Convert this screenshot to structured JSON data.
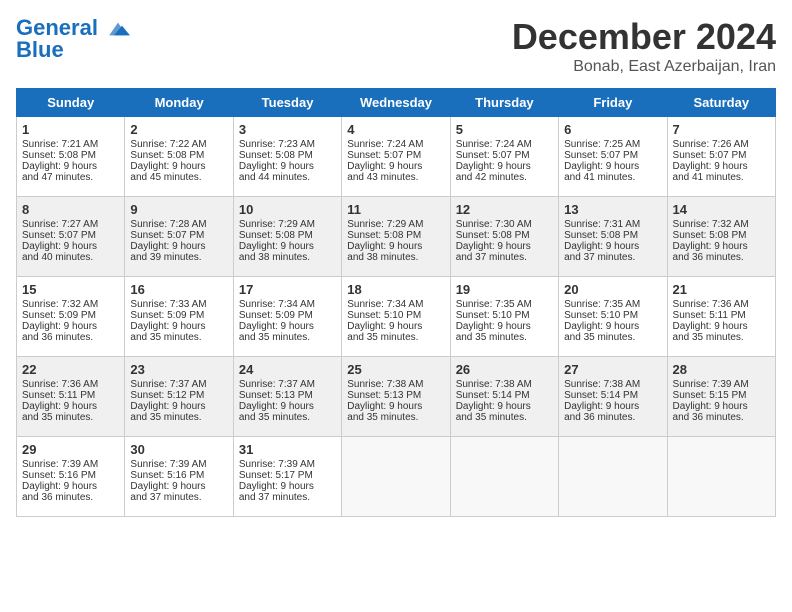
{
  "header": {
    "logo_line1": "General",
    "logo_line2": "Blue",
    "title": "December 2024",
    "subtitle": "Bonab, East Azerbaijan, Iran"
  },
  "days_of_week": [
    "Sunday",
    "Monday",
    "Tuesday",
    "Wednesday",
    "Thursday",
    "Friday",
    "Saturday"
  ],
  "weeks": [
    [
      {
        "day": "1",
        "lines": [
          "Sunrise: 7:21 AM",
          "Sunset: 5:08 PM",
          "Daylight: 9 hours",
          "and 47 minutes."
        ]
      },
      {
        "day": "2",
        "lines": [
          "Sunrise: 7:22 AM",
          "Sunset: 5:08 PM",
          "Daylight: 9 hours",
          "and 45 minutes."
        ]
      },
      {
        "day": "3",
        "lines": [
          "Sunrise: 7:23 AM",
          "Sunset: 5:08 PM",
          "Daylight: 9 hours",
          "and 44 minutes."
        ]
      },
      {
        "day": "4",
        "lines": [
          "Sunrise: 7:24 AM",
          "Sunset: 5:07 PM",
          "Daylight: 9 hours",
          "and 43 minutes."
        ]
      },
      {
        "day": "5",
        "lines": [
          "Sunrise: 7:24 AM",
          "Sunset: 5:07 PM",
          "Daylight: 9 hours",
          "and 42 minutes."
        ]
      },
      {
        "day": "6",
        "lines": [
          "Sunrise: 7:25 AM",
          "Sunset: 5:07 PM",
          "Daylight: 9 hours",
          "and 41 minutes."
        ]
      },
      {
        "day": "7",
        "lines": [
          "Sunrise: 7:26 AM",
          "Sunset: 5:07 PM",
          "Daylight: 9 hours",
          "and 41 minutes."
        ]
      }
    ],
    [
      {
        "day": "8",
        "lines": [
          "Sunrise: 7:27 AM",
          "Sunset: 5:07 PM",
          "Daylight: 9 hours",
          "and 40 minutes."
        ]
      },
      {
        "day": "9",
        "lines": [
          "Sunrise: 7:28 AM",
          "Sunset: 5:07 PM",
          "Daylight: 9 hours",
          "and 39 minutes."
        ]
      },
      {
        "day": "10",
        "lines": [
          "Sunrise: 7:29 AM",
          "Sunset: 5:08 PM",
          "Daylight: 9 hours",
          "and 38 minutes."
        ]
      },
      {
        "day": "11",
        "lines": [
          "Sunrise: 7:29 AM",
          "Sunset: 5:08 PM",
          "Daylight: 9 hours",
          "and 38 minutes."
        ]
      },
      {
        "day": "12",
        "lines": [
          "Sunrise: 7:30 AM",
          "Sunset: 5:08 PM",
          "Daylight: 9 hours",
          "and 37 minutes."
        ]
      },
      {
        "day": "13",
        "lines": [
          "Sunrise: 7:31 AM",
          "Sunset: 5:08 PM",
          "Daylight: 9 hours",
          "and 37 minutes."
        ]
      },
      {
        "day": "14",
        "lines": [
          "Sunrise: 7:32 AM",
          "Sunset: 5:08 PM",
          "Daylight: 9 hours",
          "and 36 minutes."
        ]
      }
    ],
    [
      {
        "day": "15",
        "lines": [
          "Sunrise: 7:32 AM",
          "Sunset: 5:09 PM",
          "Daylight: 9 hours",
          "and 36 minutes."
        ]
      },
      {
        "day": "16",
        "lines": [
          "Sunrise: 7:33 AM",
          "Sunset: 5:09 PM",
          "Daylight: 9 hours",
          "and 35 minutes."
        ]
      },
      {
        "day": "17",
        "lines": [
          "Sunrise: 7:34 AM",
          "Sunset: 5:09 PM",
          "Daylight: 9 hours",
          "and 35 minutes."
        ]
      },
      {
        "day": "18",
        "lines": [
          "Sunrise: 7:34 AM",
          "Sunset: 5:10 PM",
          "Daylight: 9 hours",
          "and 35 minutes."
        ]
      },
      {
        "day": "19",
        "lines": [
          "Sunrise: 7:35 AM",
          "Sunset: 5:10 PM",
          "Daylight: 9 hours",
          "and 35 minutes."
        ]
      },
      {
        "day": "20",
        "lines": [
          "Sunrise: 7:35 AM",
          "Sunset: 5:10 PM",
          "Daylight: 9 hours",
          "and 35 minutes."
        ]
      },
      {
        "day": "21",
        "lines": [
          "Sunrise: 7:36 AM",
          "Sunset: 5:11 PM",
          "Daylight: 9 hours",
          "and 35 minutes."
        ]
      }
    ],
    [
      {
        "day": "22",
        "lines": [
          "Sunrise: 7:36 AM",
          "Sunset: 5:11 PM",
          "Daylight: 9 hours",
          "and 35 minutes."
        ]
      },
      {
        "day": "23",
        "lines": [
          "Sunrise: 7:37 AM",
          "Sunset: 5:12 PM",
          "Daylight: 9 hours",
          "and 35 minutes."
        ]
      },
      {
        "day": "24",
        "lines": [
          "Sunrise: 7:37 AM",
          "Sunset: 5:13 PM",
          "Daylight: 9 hours",
          "and 35 minutes."
        ]
      },
      {
        "day": "25",
        "lines": [
          "Sunrise: 7:38 AM",
          "Sunset: 5:13 PM",
          "Daylight: 9 hours",
          "and 35 minutes."
        ]
      },
      {
        "day": "26",
        "lines": [
          "Sunrise: 7:38 AM",
          "Sunset: 5:14 PM",
          "Daylight: 9 hours",
          "and 35 minutes."
        ]
      },
      {
        "day": "27",
        "lines": [
          "Sunrise: 7:38 AM",
          "Sunset: 5:14 PM",
          "Daylight: 9 hours",
          "and 36 minutes."
        ]
      },
      {
        "day": "28",
        "lines": [
          "Sunrise: 7:39 AM",
          "Sunset: 5:15 PM",
          "Daylight: 9 hours",
          "and 36 minutes."
        ]
      }
    ],
    [
      {
        "day": "29",
        "lines": [
          "Sunrise: 7:39 AM",
          "Sunset: 5:16 PM",
          "Daylight: 9 hours",
          "and 36 minutes."
        ]
      },
      {
        "day": "30",
        "lines": [
          "Sunrise: 7:39 AM",
          "Sunset: 5:16 PM",
          "Daylight: 9 hours",
          "and 37 minutes."
        ]
      },
      {
        "day": "31",
        "lines": [
          "Sunrise: 7:39 AM",
          "Sunset: 5:17 PM",
          "Daylight: 9 hours",
          "and 37 minutes."
        ]
      },
      null,
      null,
      null,
      null
    ]
  ]
}
